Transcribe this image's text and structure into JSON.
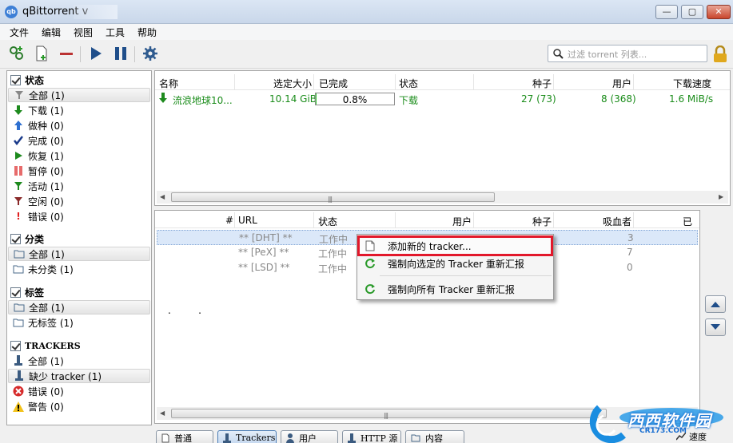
{
  "window": {
    "title": "qBittorrent v",
    "app_icon_text": "qb",
    "minimize": "—",
    "maximize": "▢",
    "close": "✕"
  },
  "menu": [
    "文件",
    "编辑",
    "视图",
    "工具",
    "帮助"
  ],
  "toolbar": {
    "buttons": [
      "add-torrent-link",
      "add-torrent-file",
      "remove",
      "resume",
      "pause",
      "options"
    ],
    "search_placeholder": "过滤 torrent 列表..."
  },
  "sidebar": {
    "status": {
      "header": "状态",
      "items": [
        {
          "label": "全部 (1)",
          "icon": "funnel-icon",
          "selected": true
        },
        {
          "label": "下载 (1)",
          "icon": "download-arrow-icon"
        },
        {
          "label": "做种 (0)",
          "icon": "upload-arrow-icon"
        },
        {
          "label": "完成 (0)",
          "icon": "checkmark-icon"
        },
        {
          "label": "恢复 (1)",
          "icon": "play-icon"
        },
        {
          "label": "暂停 (0)",
          "icon": "pause-icon"
        },
        {
          "label": "活动 (1)",
          "icon": "funnel-green-icon"
        },
        {
          "label": "空闲 (0)",
          "icon": "funnel-red-icon"
        },
        {
          "label": "错误 (0)",
          "icon": "exclamation-icon"
        }
      ]
    },
    "category": {
      "header": "分类",
      "items": [
        {
          "label": "全部 (1)",
          "icon": "folder-icon",
          "selected": true
        },
        {
          "label": "未分类 (1)",
          "icon": "folder-icon"
        }
      ]
    },
    "tags": {
      "header": "标签",
      "items": [
        {
          "label": "全部 (1)",
          "icon": "folder-icon",
          "selected": true
        },
        {
          "label": "无标签 (1)",
          "icon": "folder-icon"
        }
      ]
    },
    "trackers": {
      "header": "TRACKERS",
      "items": [
        {
          "label": "全部 (1)",
          "icon": "tracker-icon"
        },
        {
          "label": "缺少 tracker (1)",
          "icon": "tracker-icon",
          "selected": true
        },
        {
          "label": "错误 (0)",
          "icon": "error-icon"
        },
        {
          "label": "警告 (0)",
          "icon": "warning-icon"
        }
      ]
    }
  },
  "torrents": {
    "columns": [
      "名称",
      "选定大小",
      "已完成",
      "状态",
      "种子",
      "用户",
      "下载速度"
    ],
    "rows": [
      {
        "name": "流浪地球10...",
        "size": "10.14 GiB",
        "progress_text": "0.8%",
        "progress": 0.008,
        "status": "下载",
        "seeds": "27 (73)",
        "peers": "8 (368)",
        "speed": "1.6 MiB/s"
      }
    ]
  },
  "trackers": {
    "columns": [
      "#",
      "URL",
      "状态",
      "用户",
      "种子",
      "吸血者",
      "已下"
    ],
    "rows": [
      {
        "url": "** [DHT] **",
        "status": "工作中",
        "leechers": "3"
      },
      {
        "url": "** [PeX] **",
        "status": "工作中",
        "leechers": "7"
      },
      {
        "url": "** [LSD] **",
        "status": "工作中",
        "leechers": "0"
      }
    ],
    "dots": ".         ."
  },
  "context_menu": {
    "items": [
      {
        "label": "添加新的 tracker...",
        "icon": "page-add-icon"
      },
      {
        "label": "强制向选定的 Tracker 重新汇报",
        "icon": "refresh-icon"
      },
      {
        "label": "强制向所有 Tracker 重新汇报",
        "icon": "refresh-icon"
      }
    ]
  },
  "tabs": [
    {
      "label": "普通",
      "icon": "document-icon"
    },
    {
      "label": "Trackers",
      "icon": "tracker-icon",
      "active": true
    },
    {
      "label": "用户",
      "icon": "user-icon"
    },
    {
      "label": "HTTP 源",
      "icon": "tracker-icon"
    },
    {
      "label": "内容",
      "icon": "folder-icon"
    }
  ],
  "speed_tab": "速度",
  "watermark": {
    "text": "西西软件园",
    "url": "CR173.COM"
  },
  "colors": {
    "accent_green": "#1a8c1a",
    "highlight_red": "#e2182b",
    "selection_blue": "#dbe8f9"
  }
}
